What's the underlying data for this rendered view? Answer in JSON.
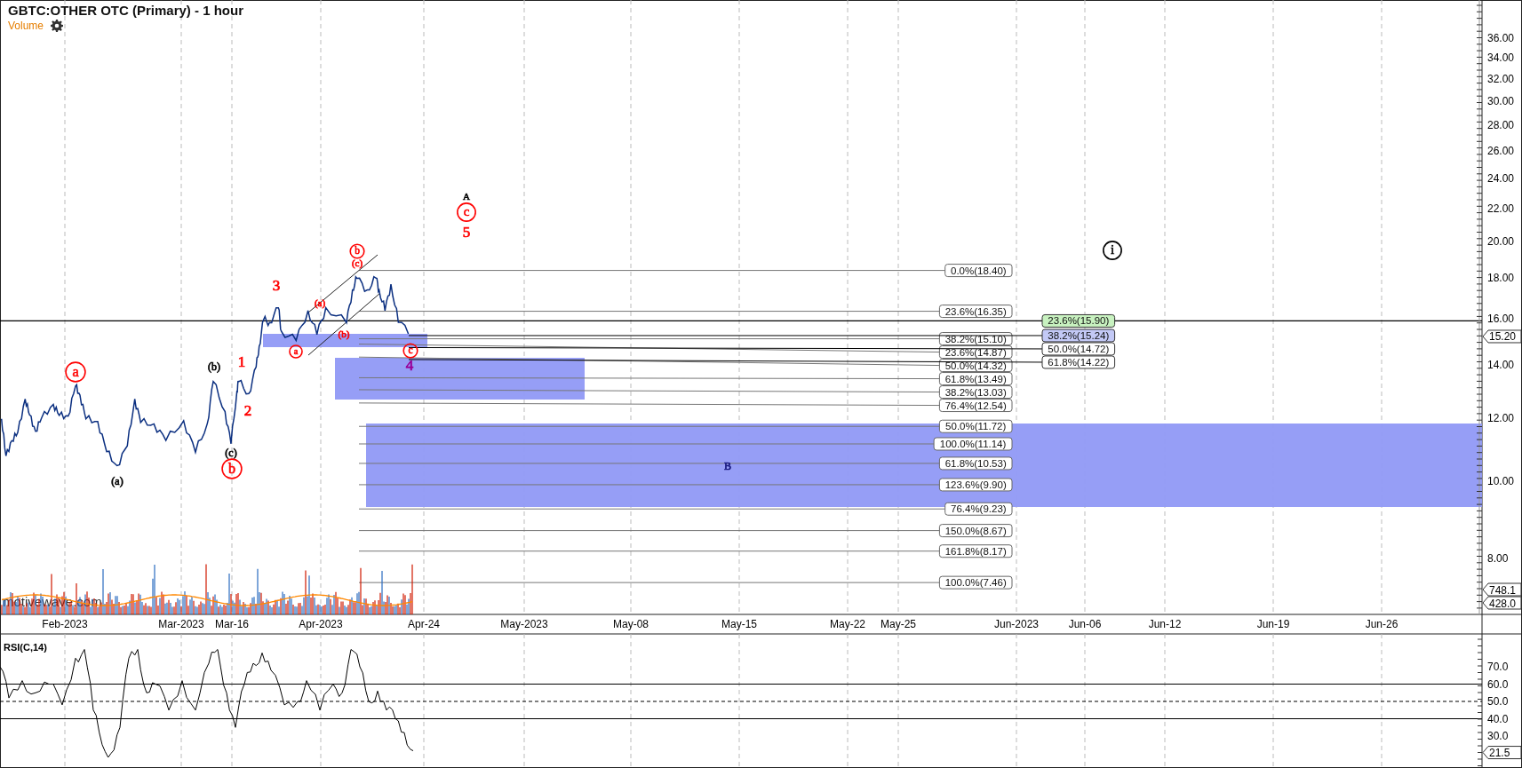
{
  "chart": {
    "title": "GBTC:OTHER OTC (Primary) - 1 hour",
    "indicator": "Volume",
    "watermark": "motivewave.com"
  },
  "price_axis": {
    "ticks": [
      "36.00",
      "34.00",
      "32.00",
      "30.00",
      "28.00",
      "26.00",
      "24.00",
      "22.00",
      "20.00",
      "18.00",
      "16.00",
      "14.00",
      "12.00",
      "10.00",
      "8.00"
    ],
    "current_price": "15.20",
    "volume_markers": [
      "748.1",
      "428.0"
    ]
  },
  "time_axis": {
    "labels": [
      "Feb-2023",
      "Mar-2023",
      "Mar-16",
      "Apr-2023",
      "Apr-24",
      "May-2023",
      "May-08",
      "May-15",
      "May-22",
      "May-25",
      "Jun-2023",
      "Jun-06",
      "Jun-12",
      "Jun-19",
      "Jun-26"
    ]
  },
  "fib_levels_left": [
    {
      "label": "0.0%(18.40)"
    },
    {
      "label": "23.6%(16.35)"
    },
    {
      "label": "38.2%(15.10)"
    },
    {
      "label": "23.6%(14.87)"
    },
    {
      "label": "50.0%(14.32)"
    },
    {
      "label": "61.8%(13.49)"
    },
    {
      "label": "38.2%(13.03)"
    },
    {
      "label": "76.4%(12.54)"
    },
    {
      "label": "50.0%(11.72)"
    },
    {
      "label": "100.0%(11.14)"
    },
    {
      "label": "61.8%(10.53)"
    },
    {
      "label": "123.6%(9.90)"
    },
    {
      "label": "76.4%(9.23)"
    },
    {
      "label": "150.0%(8.67)"
    },
    {
      "label": "161.8%(8.17)"
    },
    {
      "label": "100.0%(7.46)"
    }
  ],
  "fib_levels_right": [
    {
      "label": "23.6%(15.90)",
      "color": "#c8f2c0"
    },
    {
      "label": "38.2%(15.24)",
      "color": "#c3c9f6"
    },
    {
      "label": "50.0%(14.72)",
      "color": "#ffffff"
    },
    {
      "label": "61.8%(14.22)",
      "color": "#ffffff"
    }
  ],
  "wave_labels": [
    {
      "text": "a",
      "kind": "circled",
      "color": "#ff0000"
    },
    {
      "text": "(a)",
      "kind": "plain",
      "color": "#000000"
    },
    {
      "text": "(b)",
      "kind": "plain",
      "color": "#000000"
    },
    {
      "text": "(c)",
      "kind": "plain",
      "color": "#000000"
    },
    {
      "text": "b",
      "kind": "circled",
      "color": "#ff0000"
    },
    {
      "text": "1",
      "kind": "plain",
      "color": "#ff0000"
    },
    {
      "text": "2",
      "kind": "plain",
      "color": "#ff0000"
    },
    {
      "text": "3",
      "kind": "plain",
      "color": "#ff0000"
    },
    {
      "text": "a",
      "kind": "circled",
      "color": "#ff0000"
    },
    {
      "text": "(a)",
      "kind": "plain",
      "color": "#ff0000"
    },
    {
      "text": "(b)",
      "kind": "plain",
      "color": "#ff0000"
    },
    {
      "text": "b",
      "kind": "circled",
      "color": "#ff0000"
    },
    {
      "text": "(c)",
      "kind": "plain",
      "color": "#ff0000"
    },
    {
      "text": "c",
      "kind": "circled",
      "color": "#ff0000"
    },
    {
      "text": "4",
      "kind": "plain",
      "color": "#990099"
    },
    {
      "text": "A",
      "kind": "plain",
      "color": "#000000"
    },
    {
      "text": "c",
      "kind": "circled",
      "color": "#ff0000"
    },
    {
      "text": "5",
      "kind": "plain",
      "color": "#ff0000"
    },
    {
      "text": "B",
      "kind": "plain",
      "color": "#1a1a80"
    },
    {
      "text": "i",
      "kind": "circled",
      "color": "#000000"
    }
  ],
  "rsi": {
    "title": "RSI(C,14)",
    "ticks": [
      "70.0",
      "60.0",
      "50.0",
      "40.0",
      "30.0"
    ],
    "current": "21.5"
  }
}
